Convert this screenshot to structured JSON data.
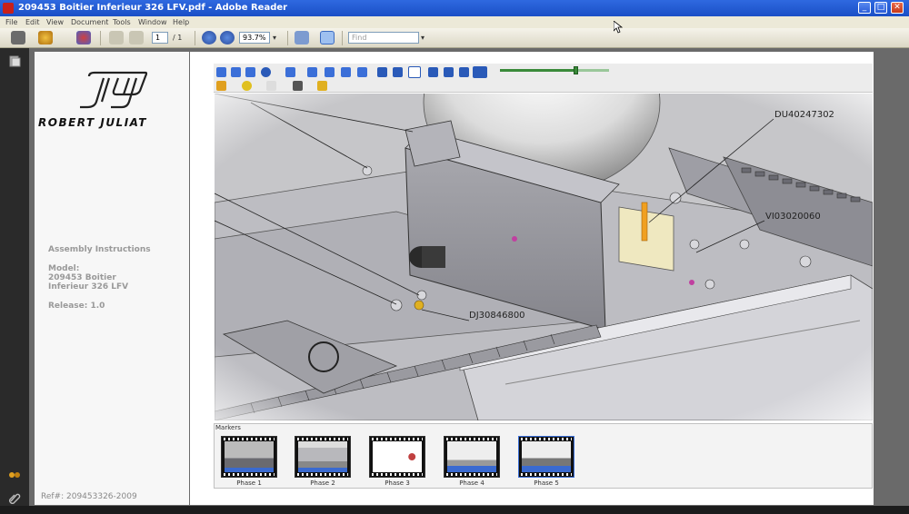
{
  "window": {
    "title": "209453 Boitier Inferieur 326 LFV.pdf - Adobe Reader",
    "minimize": "_",
    "maximize": "□",
    "close": "✕"
  },
  "menubar": {
    "items": [
      "File",
      "Edit",
      "View",
      "Document",
      "Tools",
      "Window",
      "Help"
    ]
  },
  "toolbar": {
    "page_current": "1",
    "page_total": "/ 1",
    "zoom": "93.7%",
    "find_placeholder": "Find"
  },
  "sidebar": {
    "brand": "ROBERT JULIAT",
    "section_title": "Assembly Instructions",
    "model_label": "Model:",
    "model_line1": "209453 Boitier",
    "model_line2": "Inferieur 326 LFV",
    "release": "Release: 1.0",
    "ref": "Ref#: 209453326-2009"
  },
  "viewer": {
    "callouts": [
      "DU40247302",
      "VI03020060",
      "DJ30846800"
    ],
    "slider_progress": 0.7
  },
  "markers": {
    "label": "Markers",
    "phases": [
      "Phase 1",
      "Phase 2",
      "Phase 3",
      "Phase 4",
      "Phase 5"
    ],
    "active_index": 4
  },
  "colors": {
    "titlebar": "#1a4fc6",
    "accent_green": "#3a8a3a"
  }
}
